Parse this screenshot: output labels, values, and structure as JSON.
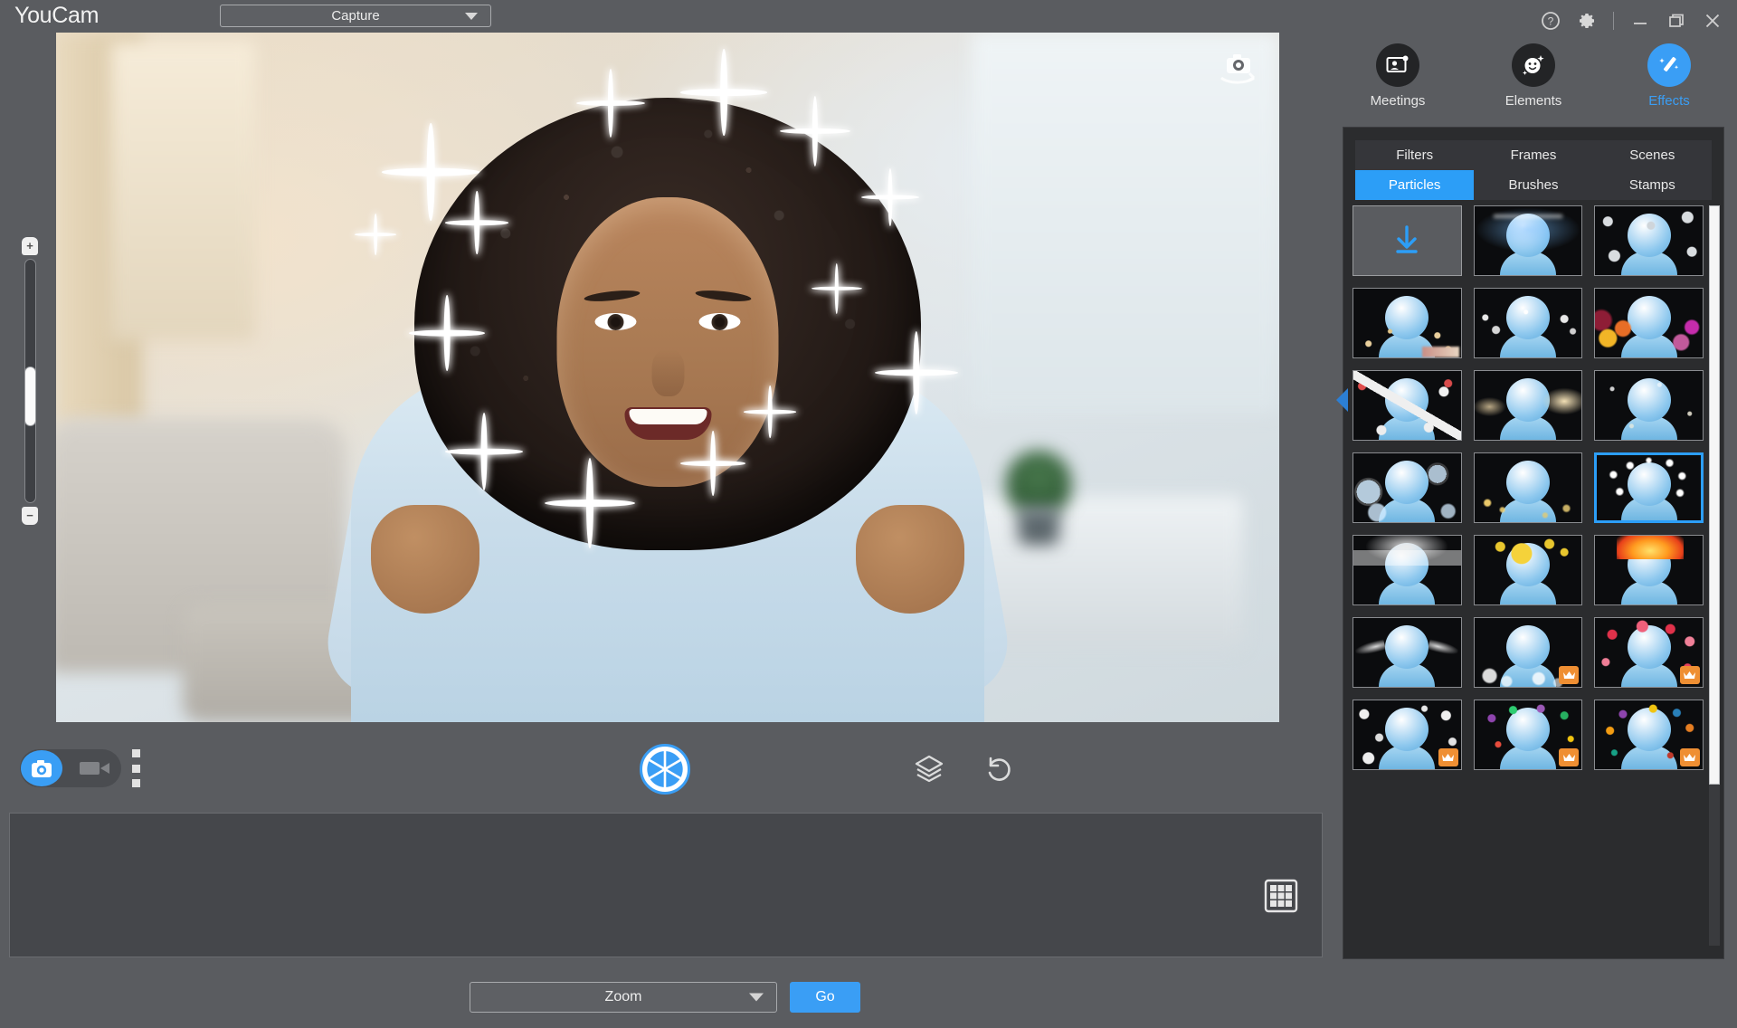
{
  "app": {
    "name": "YouCam",
    "mode_select": {
      "value": "Capture",
      "icon": "chevron-down-icon"
    }
  },
  "window_controls": [
    {
      "name": "help-icon",
      "label": "?"
    },
    {
      "name": "settings-gear-icon",
      "label": ""
    },
    {
      "name": "minimize-icon",
      "label": ""
    },
    {
      "name": "restore-icon",
      "label": ""
    },
    {
      "name": "close-icon",
      "label": ""
    }
  ],
  "preview": {
    "camera_switch_icon": "switch-camera-icon",
    "effect_applied": "Sparkles",
    "zoom_slider": {
      "increase": "+",
      "decrease": "−",
      "value": 50
    }
  },
  "capture_toolbar": {
    "photo_mode_icon": "camera-icon",
    "video_mode_icon": "camcorder-icon",
    "more_options_icon": "kebab-menu-icon",
    "shutter_icon": "aperture-shutter-icon",
    "layers_icon": "layers-icon",
    "reset_icon": "undo-reset-icon"
  },
  "gallery": {
    "grid_view_icon": "grid-view-icon",
    "items": []
  },
  "bottom_bar": {
    "zoom_select": {
      "value": "Zoom",
      "icon": "chevron-down-icon"
    },
    "go_label": "Go"
  },
  "right_panel": {
    "tabs": [
      {
        "label": "Meetings",
        "icon": "meetings-icon",
        "active": false
      },
      {
        "label": "Elements",
        "icon": "elements-smiley-icon",
        "active": false
      },
      {
        "label": "Effects",
        "icon": "magic-wand-icon",
        "active": true
      }
    ],
    "subtabs": [
      {
        "label": "Filters",
        "active": false
      },
      {
        "label": "Frames",
        "active": false
      },
      {
        "label": "Scenes",
        "active": false
      },
      {
        "label": "Particles",
        "active": true
      },
      {
        "label": "Brushes",
        "active": false
      },
      {
        "label": "Stamps",
        "active": false
      }
    ],
    "collapse_arrow_icon": "collapse-panel-arrow-icon",
    "thumbnails": [
      {
        "name": "download-more",
        "kind": "download",
        "premium": false,
        "selected": false
      },
      {
        "name": "blue-glow-sparkle",
        "kind": "glow-blue",
        "premium": false,
        "selected": false
      },
      {
        "name": "snowflakes",
        "kind": "snow",
        "premium": false,
        "selected": false
      },
      {
        "name": "gold-confetti",
        "kind": "gold-dots",
        "premium": false,
        "selected": false
      },
      {
        "name": "white-shards",
        "kind": "shards",
        "premium": false,
        "selected": false
      },
      {
        "name": "color-bokeh",
        "kind": "bokeh",
        "premium": false,
        "selected": false
      },
      {
        "name": "playing-cards",
        "kind": "cards",
        "premium": false,
        "selected": false
      },
      {
        "name": "warm-lens-flare",
        "kind": "flare",
        "premium": false,
        "selected": false
      },
      {
        "name": "soft-dust",
        "kind": "dust",
        "premium": false,
        "selected": false
      },
      {
        "name": "soap-bubbles",
        "kind": "bubbles",
        "premium": false,
        "selected": false
      },
      {
        "name": "gold-fireflies",
        "kind": "fireflies",
        "premium": false,
        "selected": false
      },
      {
        "name": "star-sparkles",
        "kind": "sparkle-stars",
        "premium": false,
        "selected": true
      },
      {
        "name": "rain-cloud",
        "kind": "rain",
        "premium": false,
        "selected": false
      },
      {
        "name": "yellow-stars",
        "kind": "yellow-stars",
        "premium": false,
        "selected": false
      },
      {
        "name": "fire-flames",
        "kind": "fire",
        "premium": false,
        "selected": false
      },
      {
        "name": "angel-wings",
        "kind": "wings",
        "premium": false,
        "selected": false
      },
      {
        "name": "white-bubbles",
        "kind": "white-bubbles",
        "premium": true,
        "selected": false
      },
      {
        "name": "red-petals",
        "kind": "petals",
        "premium": true,
        "selected": false
      },
      {
        "name": "snow-burst",
        "kind": "snow-burst",
        "premium": true,
        "selected": false
      },
      {
        "name": "party-confetti",
        "kind": "confetti",
        "premium": true,
        "selected": false
      },
      {
        "name": "celebration-streamers",
        "kind": "streamers",
        "premium": true,
        "selected": false
      }
    ]
  },
  "colors": {
    "accent": "#3a9ef5",
    "panel_bg": "#2b2c2e",
    "app_bg": "#5a5c60",
    "premium_badge": "#ef8f33"
  }
}
